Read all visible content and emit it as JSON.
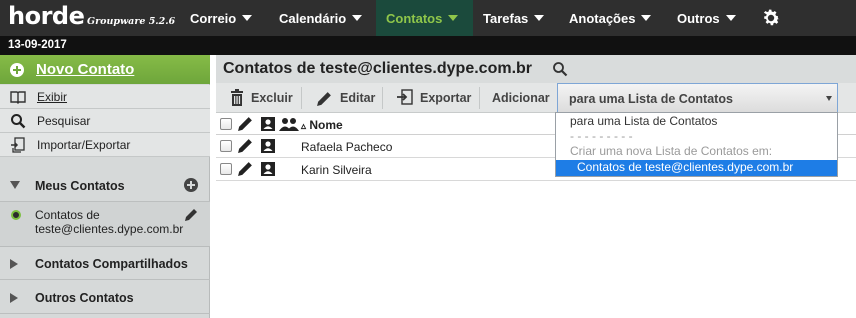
{
  "app": {
    "logo": "horde",
    "product": "Groupware 5.2.6",
    "date": "13-09-2017"
  },
  "nav": {
    "items": [
      {
        "label": "Correio"
      },
      {
        "label": "Calendário"
      },
      {
        "label": "Contatos",
        "active": true
      },
      {
        "label": "Tarefas"
      },
      {
        "label": "Anotações"
      },
      {
        "label": "Outros"
      }
    ],
    "settings_icon": "gear-icon"
  },
  "sidebar": {
    "new_contact": "Novo Contato",
    "actions": [
      {
        "label": "Exibir",
        "icon": "book-icon"
      },
      {
        "label": "Pesquisar",
        "icon": "search-icon"
      },
      {
        "label": "Importar/Exportar",
        "icon": "import-export-icon"
      }
    ],
    "my_contacts": "Meus Contatos",
    "address_book": "Contatos de teste@clientes.dype.com.br",
    "shared_contacts": "Contatos Compartilhados",
    "other_contacts": "Outros Contatos"
  },
  "main": {
    "title": "Contatos de teste@clientes.dype.com.br",
    "toolbar": {
      "delete": "Excluir",
      "edit": "Editar",
      "export": "Exportar",
      "add": "Adicionar",
      "list_select": "para uma Lista de Contatos"
    },
    "list": {
      "sort_indicator": "▵",
      "column_name": "Nome",
      "rows": [
        {
          "name": "Rafaela Pacheco"
        },
        {
          "name": "Karin Silveira"
        }
      ]
    },
    "dropdown": {
      "option_1": "para uma Lista de Contatos",
      "separator": "- - - - - - - - -",
      "create_new": "Criar uma nova Lista de Contatos em:",
      "selected": "Contatos de teste@clientes.dype.com.br"
    }
  },
  "colors": {
    "topbar": "#2f2f2f",
    "active_nav": "#1b4a3c",
    "accent_green": "#7bb341",
    "selection_blue": "#1e7de6"
  }
}
